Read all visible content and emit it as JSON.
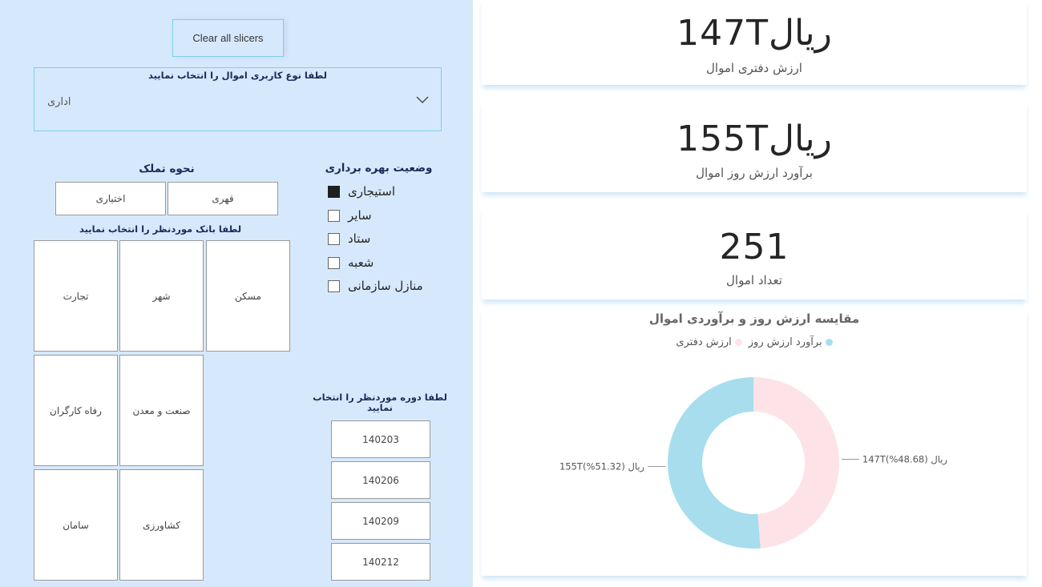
{
  "left_panel": {
    "clear_button": "Clear all slicers",
    "usage_type": {
      "title": "لطفا نوع کاربری اموال را انتخاب نمایید",
      "selected": "اداری"
    },
    "ownership": {
      "title": "نحوه تملک",
      "options": [
        "قهری",
        "اختیاری"
      ]
    },
    "utilization": {
      "title": "وضعیت بهره برداری",
      "items": [
        {
          "label": "استیجاری",
          "checked": true
        },
        {
          "label": "سایر",
          "checked": false
        },
        {
          "label": "ستاد",
          "checked": false
        },
        {
          "label": "شعبه",
          "checked": false
        },
        {
          "label": "منازل سازمانی",
          "checked": false
        }
      ]
    },
    "banks": {
      "title": "لطفا بانک موردنظر را انتخاب نمایید",
      "items": [
        "مسکن",
        "شهر",
        "تجارت",
        "صنعت و معدن",
        "رفاه کارگران",
        "کشاورزی",
        "سامان"
      ]
    },
    "periods": {
      "title": "لطفا دوره موردنظر را انتخاب نمایید",
      "items": [
        "140203",
        "140206",
        "140209",
        "140212"
      ]
    }
  },
  "kpis": [
    {
      "value": "147Tریال",
      "label": "ارزش دفتری اموال"
    },
    {
      "value": "155Tریال",
      "label": "برآورد ارزش روز اموال"
    },
    {
      "value": "251",
      "label": "تعداد اموال"
    }
  ],
  "colors": {
    "left_bg": "#d6e9fc",
    "book_value": "#fde3e8",
    "current_value": "#a8dded"
  },
  "chart_data": {
    "type": "pie",
    "title": "مقایسه ارزش روز و برآوردی اموال",
    "series": [
      {
        "name": "ارزش دفتری",
        "value": 48.68,
        "label": "147Tریال (48.68%)",
        "color": "#fde3e8"
      },
      {
        "name": "برآورد ارزش روز",
        "value": 51.32,
        "label": "155Tریال (51.32%)",
        "color": "#a8dded"
      }
    ],
    "donut": true,
    "legend_position": "top-center"
  }
}
